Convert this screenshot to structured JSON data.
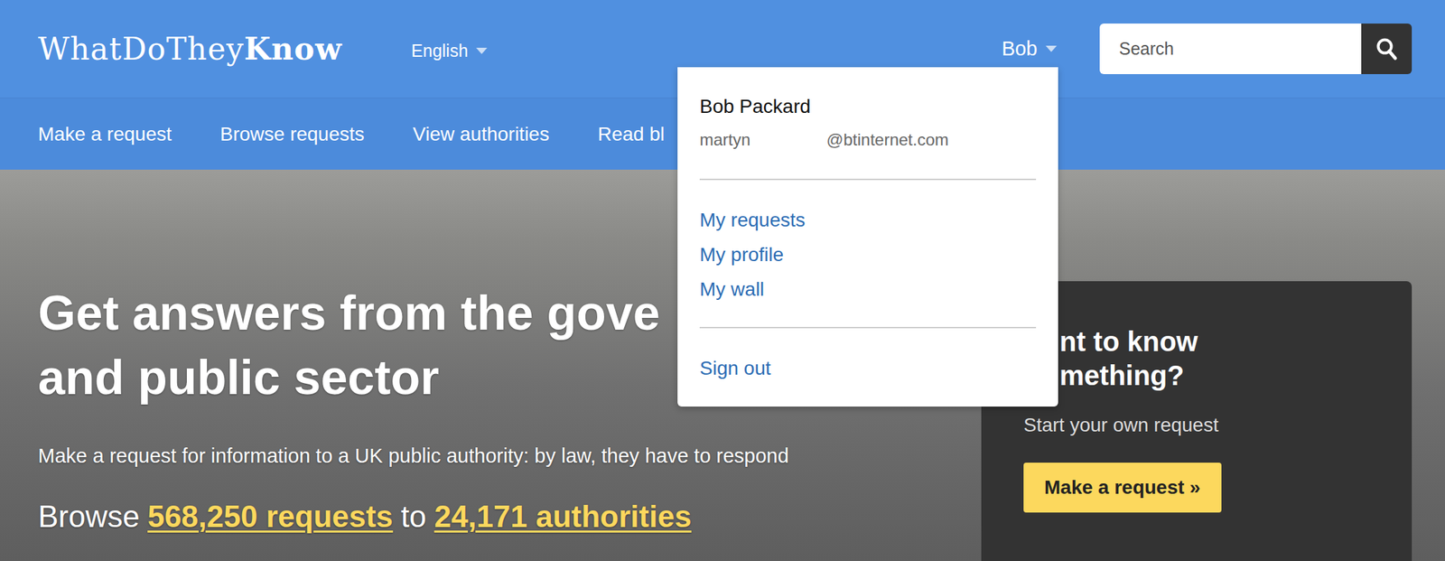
{
  "logo": {
    "light": "WhatDoThey",
    "bold": "Know"
  },
  "language": {
    "label": "English"
  },
  "user": {
    "short_name": "Bob",
    "menu_open": true
  },
  "search": {
    "placeholder": "Search"
  },
  "nav": [
    {
      "label": "Make a request"
    },
    {
      "label": "Browse requests"
    },
    {
      "label": "View authorities"
    },
    {
      "label": "Read bl"
    }
  ],
  "user_menu": {
    "name": "Bob Packard",
    "email_start": "martyn",
    "email_end": "@btinternet.com",
    "links": [
      "My requests",
      "My profile",
      "My wall"
    ],
    "sign_out": "Sign out"
  },
  "hero": {
    "heading": [
      "Get answers from the gove",
      "and public sector"
    ],
    "subtitle": "Make a request for information to a UK public authority: by law, they have to respond",
    "browse": {
      "prefix": "Browse",
      "requests": "568,250 requests",
      "middle": "to",
      "authorities": "24,171 authorities"
    }
  },
  "cta": {
    "heading": [
      "nt to know",
      "mething?"
    ],
    "text": "Start your own request",
    "button": "Make a request »"
  }
}
